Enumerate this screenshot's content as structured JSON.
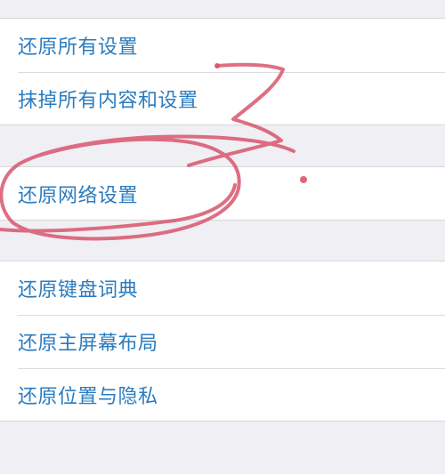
{
  "groups": [
    {
      "items": [
        {
          "label": "还原所有设置"
        },
        {
          "label": "抹掉所有内容和设置"
        }
      ]
    },
    {
      "items": [
        {
          "label": "还原网络设置"
        }
      ]
    },
    {
      "items": [
        {
          "label": "还原键盘词典"
        },
        {
          "label": "还原主屏幕布局"
        },
        {
          "label": "还原位置与隐私"
        }
      ]
    }
  ],
  "colors": {
    "background": "#efeff4",
    "cell": "#ffffff",
    "link_text": "#2b7cbf",
    "annotation_ink": "#d9566e"
  }
}
